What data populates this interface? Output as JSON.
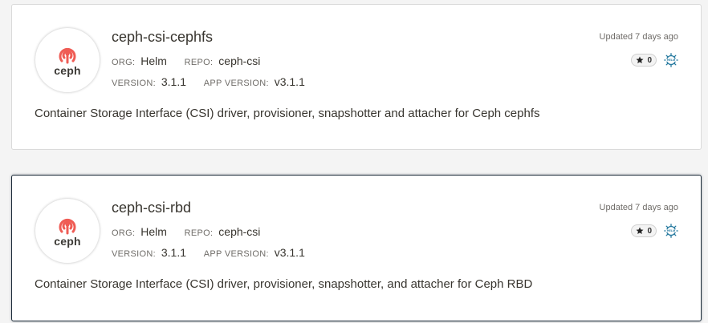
{
  "packages": [
    {
      "name": "ceph-csi-cephfs",
      "logo_text": "ceph",
      "org_label": "ORG:",
      "org": "Helm",
      "repo_label": "REPO:",
      "repo": "ceph-csi",
      "version_label": "VERSION:",
      "version": "3.1.1",
      "app_version_label": "APP VERSION:",
      "app_version": "v3.1.1",
      "description": "Container Storage Interface (CSI) driver, provisioner, snapshotter and attacher for Ceph cephfs",
      "updated": "Updated 7 days ago",
      "stars": "0",
      "kind_icon": "helm-icon"
    },
    {
      "name": "ceph-csi-rbd",
      "logo_text": "ceph",
      "org_label": "ORG:",
      "org": "Helm",
      "repo_label": "REPO:",
      "repo": "ceph-csi",
      "version_label": "VERSION:",
      "version": "3.1.1",
      "app_version_label": "APP VERSION:",
      "app_version": "v3.1.1",
      "description": "Container Storage Interface (CSI) driver, provisioner, snapshotter, and attacher for Ceph RBD",
      "updated": "Updated 7 days ago",
      "stars": "0",
      "kind_icon": "helm-icon"
    }
  ],
  "colors": {
    "ceph_red": "#ef5c55",
    "helm_blue": "#277a9f",
    "active_border": "#1c2b39"
  }
}
